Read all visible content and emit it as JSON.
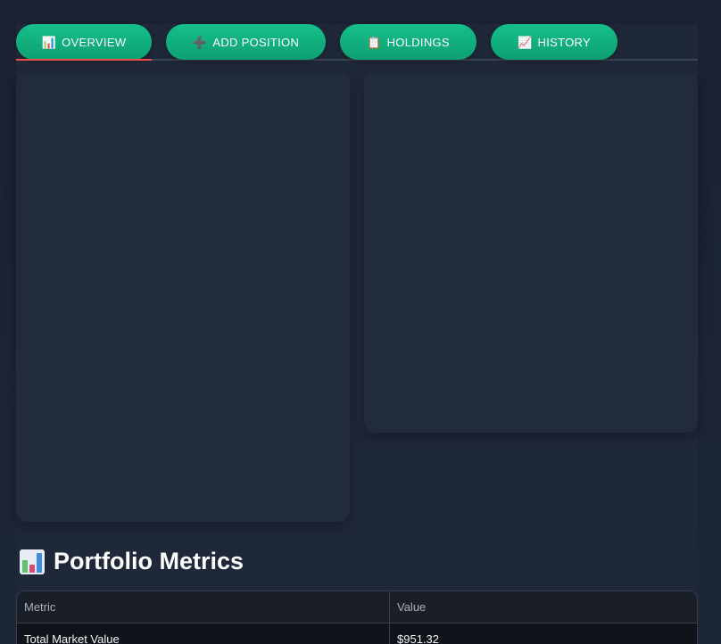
{
  "tabs": [
    {
      "label": "OVERVIEW",
      "icon": "bar-chart-icon",
      "glyph": "📊",
      "active": true
    },
    {
      "label": "ADD POSITION",
      "icon": "plus-icon",
      "glyph": "➕",
      "active": false
    },
    {
      "label": "HOLDINGS",
      "icon": "clipboard-icon",
      "glyph": "📋",
      "active": false
    },
    {
      "label": "HISTORY",
      "icon": "line-chart-icon",
      "glyph": "📈",
      "active": false
    }
  ],
  "metrics": {
    "title": "Portfolio Metrics",
    "title_icon": "bar-chart-icon",
    "columns": [
      "Metric",
      "Value"
    ],
    "rows": [
      {
        "metric": "Total Market Value",
        "value": "$951.32"
      }
    ]
  },
  "colors": {
    "tab_green": "#16c08a",
    "active_underline": "#ef4b4b",
    "background": "#1f2839"
  }
}
